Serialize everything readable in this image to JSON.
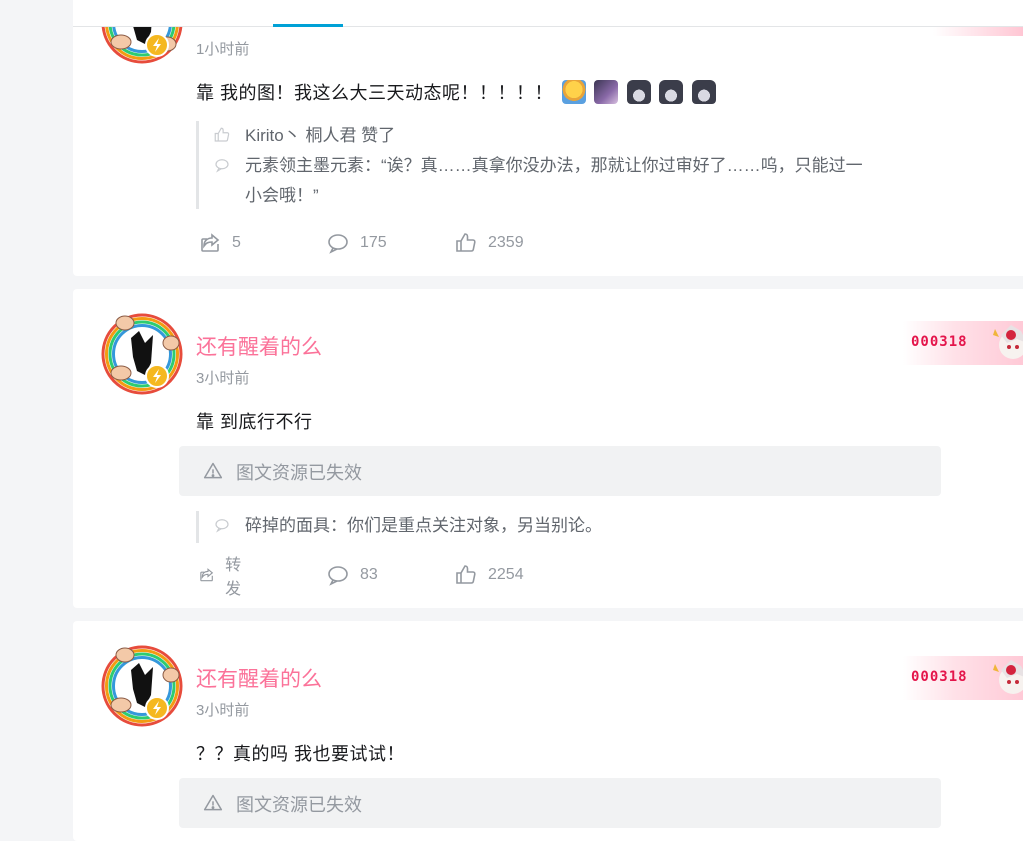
{
  "posts": [
    {
      "time": "1小时前",
      "content": "靠 我的图！我这么大三天动态呢！！！！！",
      "likes_line": "Kirito丶 桐人君 赞了",
      "comment_line": "元素领主墨元素：“诶？真……真拿你没办法，那就让你过审好了……呜，只能过一小会哦！”",
      "comment_line_2": "小会哦！”",
      "comment_line_1": "元素领主墨元素：“诶？真……真拿你没办法，那就让你过审好了……呜，只能过一",
      "forward": "5",
      "comments": "175",
      "likes": "2359"
    },
    {
      "name": "还有醒着的么",
      "time": "3小时前",
      "content": "靠 到底行不行",
      "invalid_text": "图文资源已失效",
      "comment_line": "碎掉的面具：你们是重点关注对象，另当别论。",
      "forward": "转发",
      "comments": "83",
      "likes": "2254",
      "badge_number": "000318"
    },
    {
      "name": "还有醒着的么",
      "time": "3小时前",
      "content": "？？真的吗 我也要试试！",
      "invalid_text": "图文资源已失效",
      "badge_number": "000318"
    }
  ],
  "icons": {
    "forward": "share-icon",
    "comment": "comment-icon",
    "like": "thumbs-up-icon",
    "warning": "warning-icon",
    "lightning": "lightning-badge-icon"
  },
  "colors": {
    "username": "#fb7299",
    "accent": "#00a1d6",
    "badge_number": "#e4154b",
    "muted": "#9499a0"
  }
}
